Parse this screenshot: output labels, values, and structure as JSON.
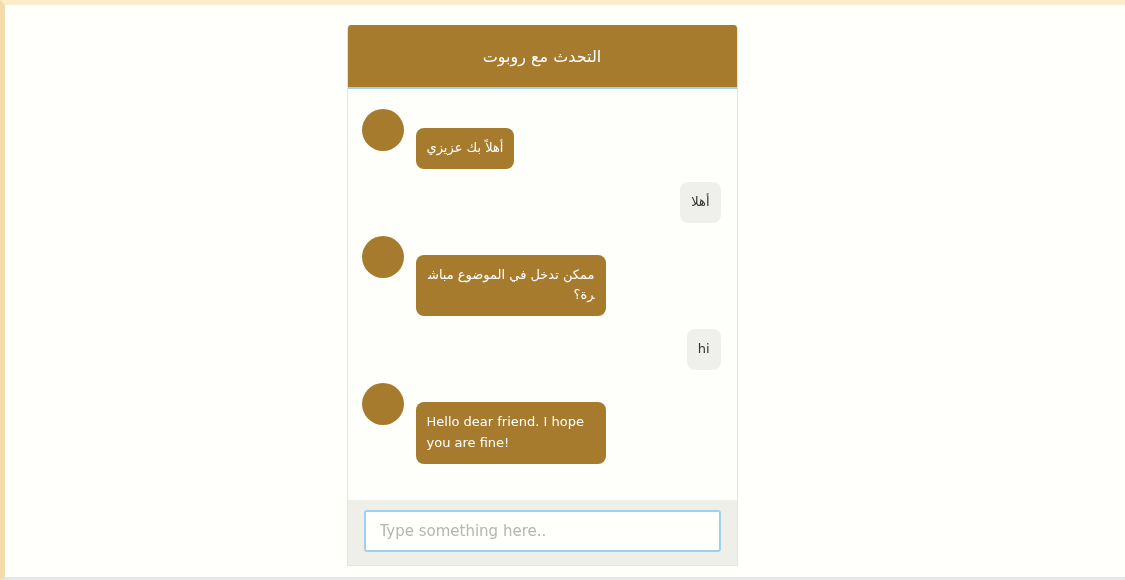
{
  "chat": {
    "title": "التحدث مع روبوت",
    "messages": [
      {
        "kind": "bot",
        "text": "أهلاً بك عزيزي"
      },
      {
        "kind": "user",
        "text": "أهلا"
      },
      {
        "kind": "bot",
        "text": "ممكن تدخل في الموضوع مباشرة؟"
      },
      {
        "kind": "user",
        "text": "hi"
      },
      {
        "kind": "bot",
        "text": "Hello dear friend. I hope you are fine!"
      }
    ],
    "input": {
      "placeholder": "Type something here.."
    }
  }
}
